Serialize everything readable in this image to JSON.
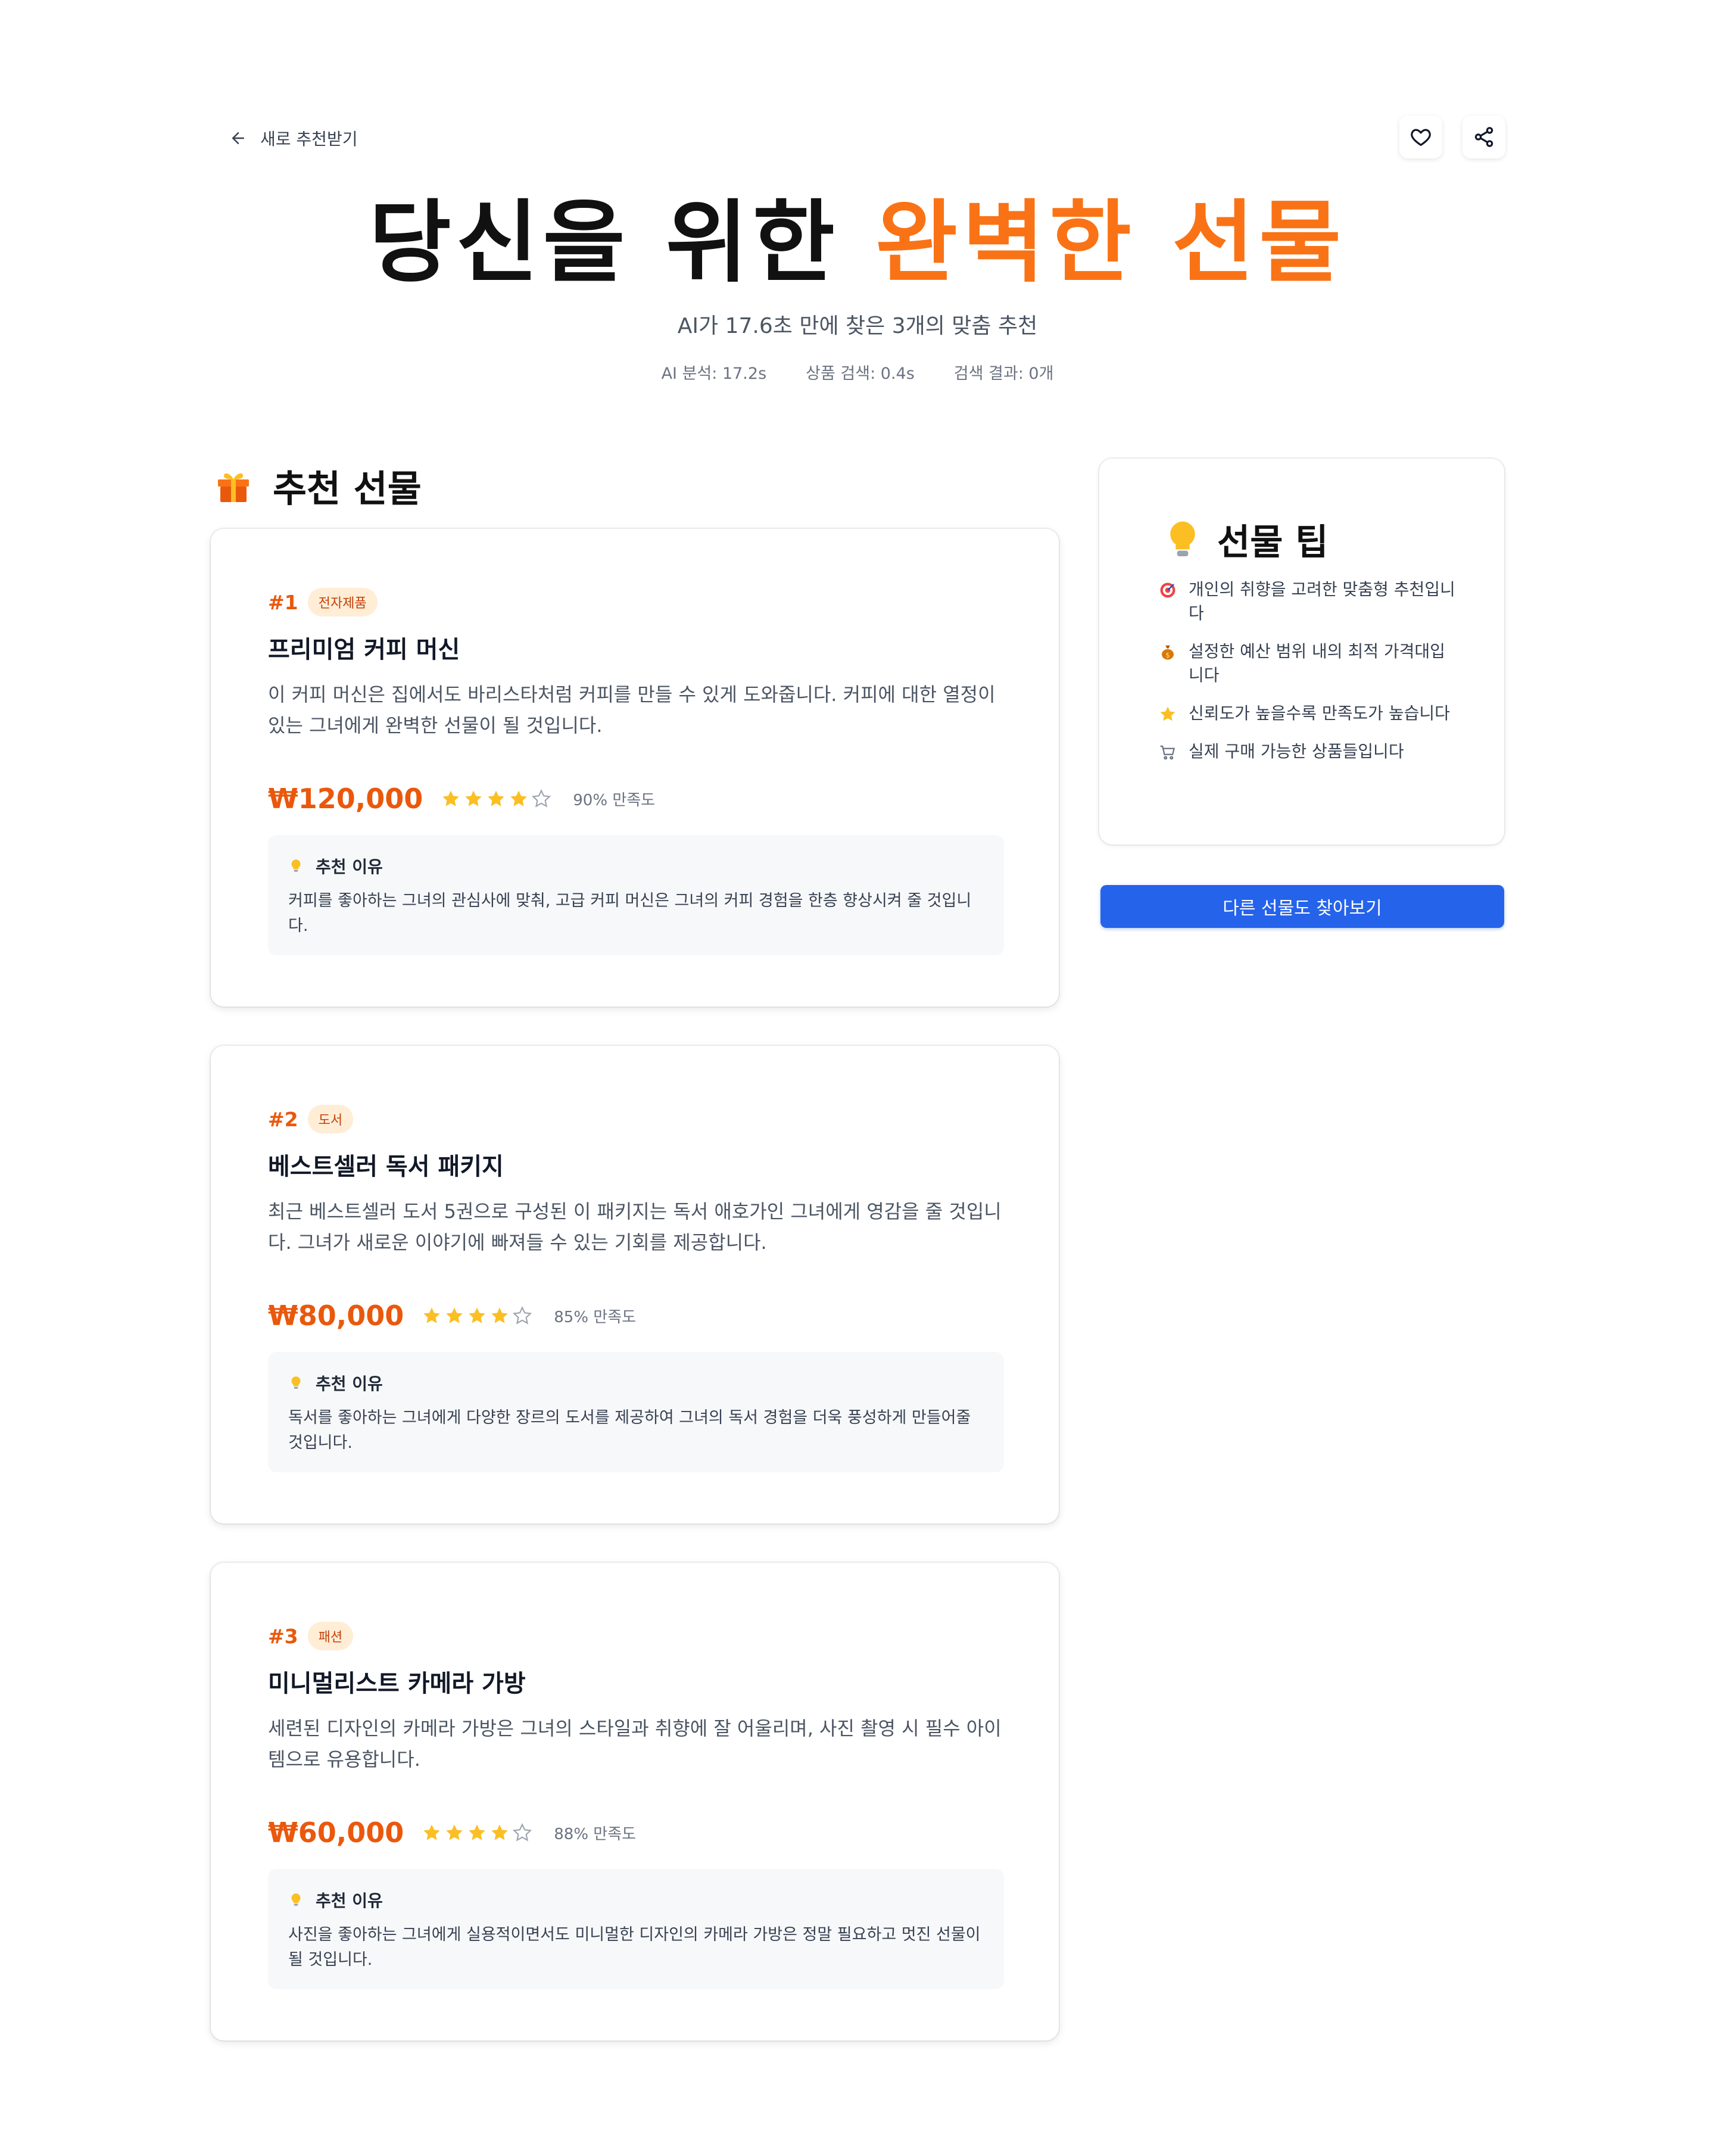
{
  "nav": {
    "back_label": "새로 추천받기"
  },
  "hero": {
    "title_main": "당신을 위한 ",
    "title_accent": "완벽한 선물",
    "subtitle": "AI가 17.6초 만에 찾은 3개의 맞춤 추천",
    "stats": [
      "AI 분석: 17.2s",
      "상품 검색: 0.4s",
      "검색 결과: 0개"
    ]
  },
  "section": {
    "title": "추천 선물"
  },
  "reason_label": "추천 이유",
  "recommendations": [
    {
      "rank": "#1",
      "category": "전자제품",
      "name": "프리미엄 커피 머신",
      "description": "이 커피 머신은 집에서도 바리스타처럼 커피를 만들 수 있게 도와줍니다. 커피에 대한 열정이 있는 그녀에게 완벽한 선물이 될 것입니다.",
      "price": "₩120,000",
      "rating": 4,
      "satisfaction": "90% 만족도",
      "reason": "커피를 좋아하는 그녀의 관심사에 맞춰, 고급 커피 머신은 그녀의 커피 경험을 한층 향상시켜 줄 것입니다."
    },
    {
      "rank": "#2",
      "category": "도서",
      "name": "베스트셀러 독서 패키지",
      "description": "최근 베스트셀러 도서 5권으로 구성된 이 패키지는 독서 애호가인 그녀에게 영감을 줄 것입니다. 그녀가 새로운 이야기에 빠져들 수 있는 기회를 제공합니다.",
      "price": "₩80,000",
      "rating": 4,
      "satisfaction": "85% 만족도",
      "reason": "독서를 좋아하는 그녀에게 다양한 장르의 도서를 제공하여 그녀의 독서 경험을 더욱 풍성하게 만들어줄 것입니다."
    },
    {
      "rank": "#3",
      "category": "패션",
      "name": "미니멀리스트 카메라 가방",
      "description": "세련된 디자인의 카메라 가방은 그녀의 스타일과 취향에 잘 어울리며, 사진 촬영 시 필수 아이템으로 유용합니다.",
      "price": "₩60,000",
      "rating": 4,
      "satisfaction": "88% 만족도",
      "reason": "사진을 좋아하는 그녀에게 실용적이면서도 미니멀한 디자인의 카메라 가방은 정말 필요하고 멋진 선물이 될 것입니다."
    }
  ],
  "tips": {
    "title": "선물 팁",
    "items": [
      {
        "icon": "target-icon",
        "text": "개인의 취향을 고려한 맞춤형 추천입니다"
      },
      {
        "icon": "money-bag-icon",
        "text": "설정한 예산 범위 내의 최적 가격대입니다"
      },
      {
        "icon": "star-icon",
        "text": "신뢰도가 높을수록 만족도가 높습니다"
      },
      {
        "icon": "cart-icon",
        "text": "실제 구매 가능한 상품들입니다"
      }
    ]
  },
  "cta": {
    "label": "다른 선물도 찾아보기"
  },
  "colors": {
    "accent": "#f97316",
    "price": "#ea580c",
    "primary": "#2563eb",
    "star": "#fbbf24"
  }
}
